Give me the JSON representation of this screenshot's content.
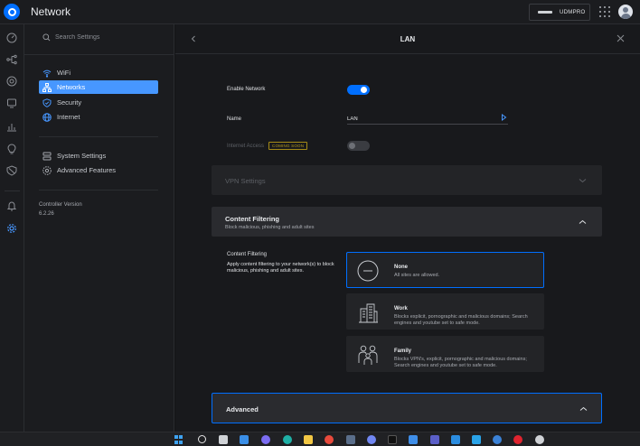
{
  "topbar": {
    "app_title": "Network",
    "device_name": "UDMPRO"
  },
  "rail": {
    "icons": [
      "dashboard-icon",
      "topology-icon",
      "devices-icon",
      "clients-icon",
      "statistics-icon",
      "insights-icon",
      "traffic-icon",
      "alerts-icon",
      "settings-icon"
    ]
  },
  "sidebar": {
    "search_placeholder": "Search Settings",
    "items": [
      {
        "label": "WiFi",
        "icon": "wifi-icon"
      },
      {
        "label": "Networks",
        "icon": "network-icon"
      },
      {
        "label": "Security",
        "icon": "shield-icon"
      },
      {
        "label": "Internet",
        "icon": "globe-icon"
      },
      {
        "label": "System Settings",
        "icon": "system-icon"
      },
      {
        "label": "Advanced Features",
        "icon": "gears-icon"
      }
    ],
    "version_label": "Controller Version",
    "version_value": "6.2.26"
  },
  "panel": {
    "title": "LAN",
    "enable_network_label": "Enable Network",
    "enable_network_on": true,
    "name_label": "Name",
    "name_value": "LAN",
    "internet_access_label": "Internet Access",
    "internet_access_badge": "COMING SOON",
    "internet_access_on": false
  },
  "sections": {
    "vpn": {
      "title": "VPN Settings"
    },
    "content_filtering": {
      "title": "Content Filtering",
      "subtitle": "Block malicious, phishing and adult sites"
    },
    "advanced": {
      "title": "Advanced"
    }
  },
  "content_filtering": {
    "label": "Content Filtering",
    "description": "Apply content filtering to your network(s) to block malicious, phishing and adult sites.",
    "options": [
      {
        "title": "None",
        "description": "All sites are allowed.",
        "icon": "none-icon",
        "selected": true
      },
      {
        "title": "Work",
        "description": "Blocks explicit, pornographic and malicious domains; Search engines and youtube set to safe mode.",
        "icon": "office-building-icon",
        "selected": false
      },
      {
        "title": "Family",
        "description": "Blocks VPN's, explicit, pornographic and malicious domains; Search engines and youtube set to safe mode.",
        "icon": "family-icon",
        "selected": false
      }
    ]
  },
  "colors": {
    "accent": "#006fff",
    "highlight": "#4797ff",
    "badge": "#b79c1e",
    "background": "#18191c"
  },
  "taskbar": {
    "icons": [
      "windows-start-icon",
      "search-icon",
      "task-view-icon",
      "widgets-icon",
      "teams-chat-icon",
      "edge-icon",
      "file-explorer-icon",
      "chrome-icon",
      "store-icon",
      "vscode-icon",
      "discord-icon",
      "terminal-icon",
      "vs-icon",
      "teams-icon",
      "app-icon",
      "photos-icon",
      "app-icon-2",
      "opera-icon",
      "app-icon-3"
    ]
  }
}
